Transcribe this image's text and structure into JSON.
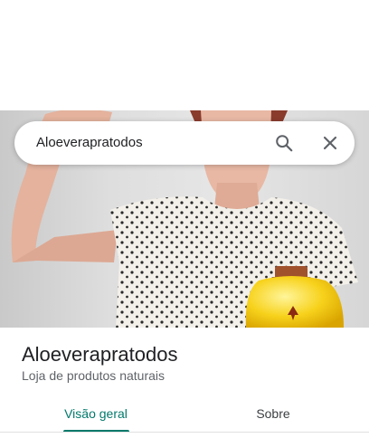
{
  "search": {
    "query": "Aloeverapratodos"
  },
  "place": {
    "name": "Aloeverapratodos",
    "category": "Loja de produtos naturais"
  },
  "tabs": [
    {
      "label": "Visão geral",
      "selected": true
    },
    {
      "label": "Sobre",
      "selected": false
    }
  ],
  "colors": {
    "accent": "#00796b",
    "text_primary": "#202124",
    "text_secondary": "#5f6368"
  },
  "icons": [
    "search-icon",
    "close-icon"
  ]
}
